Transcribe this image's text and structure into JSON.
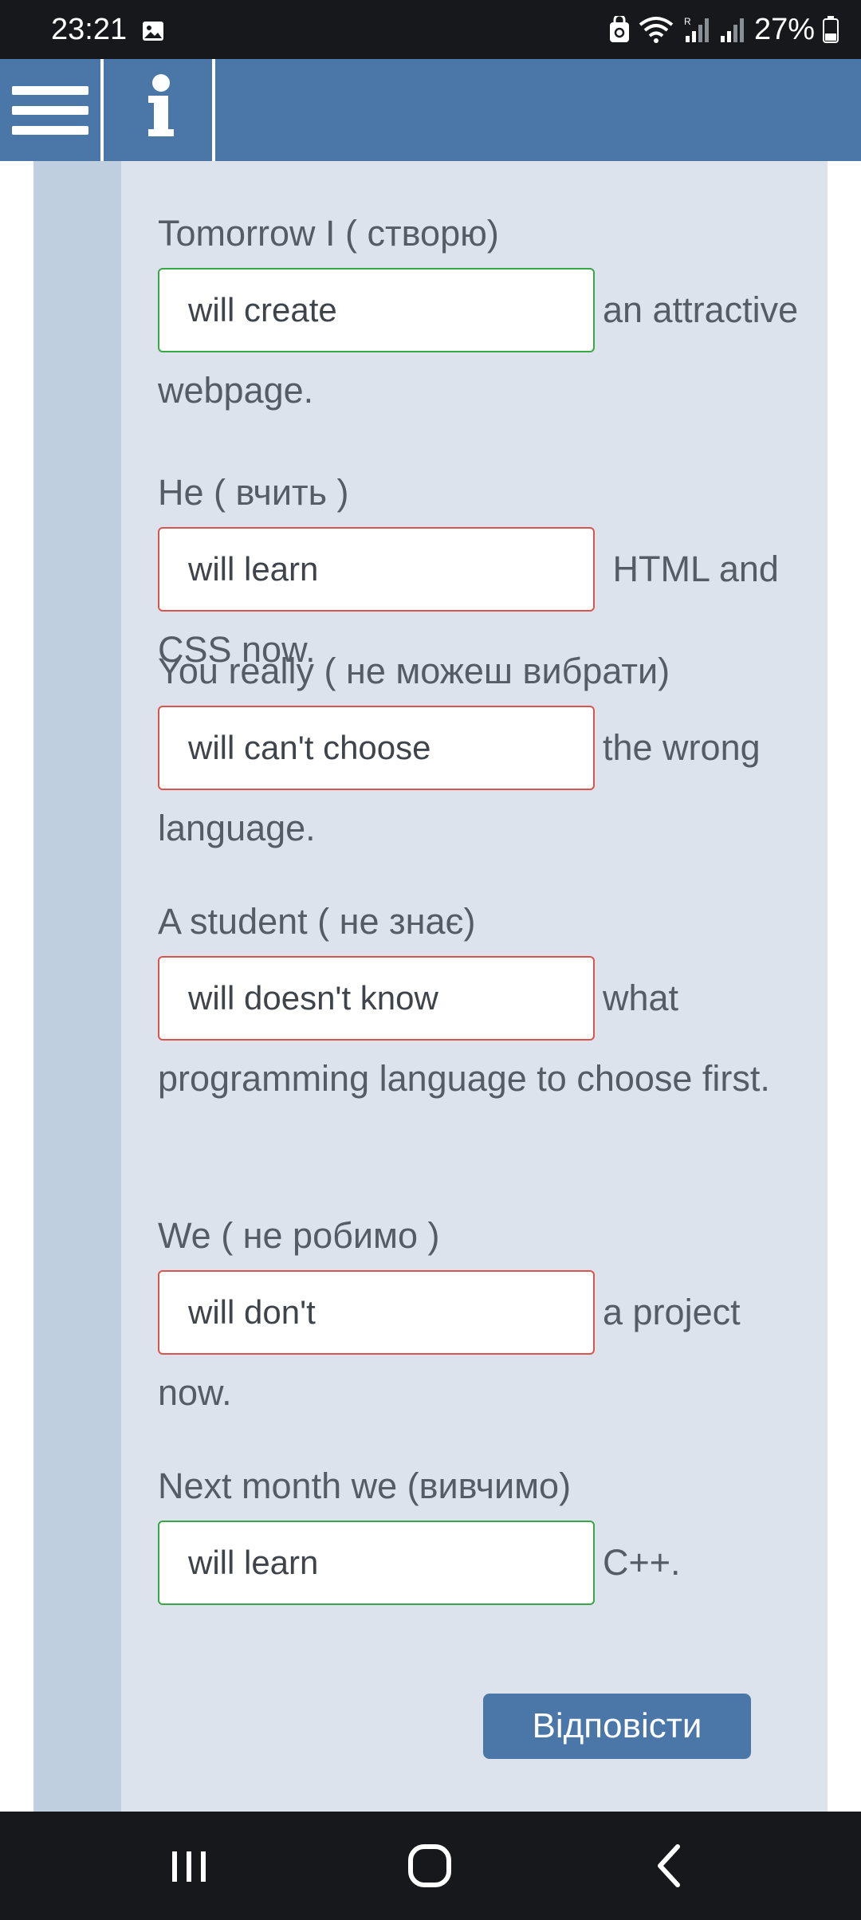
{
  "status_bar": {
    "time": "23:21",
    "battery_percent": "27%"
  },
  "header": {
    "menu_icon": "menu-icon",
    "info_icon": "info-icon",
    "accent_color": "#4a76a8"
  },
  "exercise": {
    "items": [
      {
        "prefix": "Tomorrow I ( створю)",
        "answer": "will create",
        "suffix": "an attractive webpage.",
        "status": "correct"
      },
      {
        "prefix": "He ( вчить )",
        "answer": "will learn",
        "suffix": "HTML and CSS now.",
        "status": "incorrect"
      },
      {
        "prefix": "You really ( не можеш вибрати)",
        "answer": "will can't choose",
        "suffix": "the wrong language.",
        "status": "incorrect"
      },
      {
        "prefix": "A student ( не знає)",
        "answer": "will doesn't know",
        "suffix": "what programming language to choose first.",
        "status": "incorrect"
      },
      {
        "prefix": "We ( не робимо )",
        "answer": "will don't",
        "suffix": "a project now.",
        "status": "incorrect"
      },
      {
        "prefix": "Next month we (вивчимо)",
        "answer": "will learn",
        "suffix": "C++.",
        "status": "correct"
      }
    ],
    "colors": {
      "correct": "#38a745",
      "incorrect": "#d9534f"
    }
  },
  "submit_label": "Відповісти",
  "nav_bar": {
    "icons": [
      "recent-apps-icon",
      "home-icon",
      "back-icon"
    ]
  }
}
